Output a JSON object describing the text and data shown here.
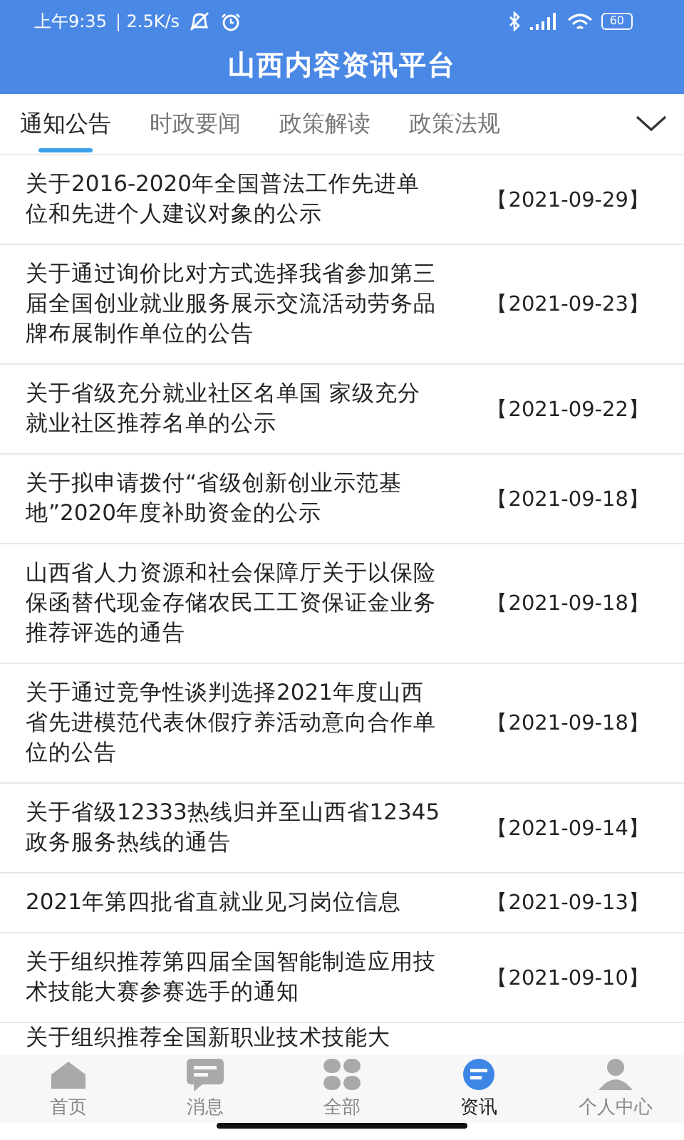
{
  "status_bar": {
    "time": "上午9:35",
    "speed": "| 2.5K/s",
    "battery": "60"
  },
  "header": {
    "title": "山西内容资讯平台"
  },
  "tabs": [
    {
      "label": "通知公告",
      "selected": true
    },
    {
      "label": "时政要闻",
      "selected": false
    },
    {
      "label": "政策解读",
      "selected": false
    },
    {
      "label": "政策法规",
      "selected": false
    }
  ],
  "articles": [
    {
      "title": "关于2016-2020年全国普法工作先进单位和先进个人建议对象的公示",
      "date": "【2021-09-29】"
    },
    {
      "title": "关于通过询价比对方式选择我省参加第三届全国创业就业服务展示交流活动劳务品牌布展制作单位的公告",
      "date": "【2021-09-23】"
    },
    {
      "title": "关于省级充分就业社区名单国 家级充分就业社区推荐名单的公示",
      "date": "【2021-09-22】"
    },
    {
      "title": "关于拟申请拨付“省级创新创业示范基地”2020年度补助资金的公示",
      "date": "【2021-09-18】"
    },
    {
      "title": "山西省人力资源和社会保障厅关于以保险保函替代现金存储农民工工资保证金业务推荐评选的通告",
      "date": "【2021-09-18】"
    },
    {
      "title": "关于通过竞争性谈判选择2021年度山西省先进模范代表休假疗养活动意向合作单位的公告",
      "date": "【2021-09-18】"
    },
    {
      "title": "关于省级12333热线归并至山西省12345政务服务热线的通告",
      "date": "【2021-09-14】"
    },
    {
      "title": "2021年第四批省直就业见习岗位信息",
      "date": "【2021-09-13】"
    },
    {
      "title": "关于组织推荐第四届全国智能制造应用技术技能大赛参赛选手的通知",
      "date": "【2021-09-10】"
    },
    {
      "title": "关于组织推荐全国新职业技术技能大"
    }
  ],
  "bottom_nav": [
    {
      "label": "首页",
      "kind": "home",
      "selected": false
    },
    {
      "label": "消息",
      "kind": "message",
      "selected": false
    },
    {
      "label": "全部",
      "kind": "grid",
      "selected": false
    },
    {
      "label": "资讯",
      "kind": "news",
      "selected": true
    },
    {
      "label": "个人中心",
      "kind": "person",
      "selected": false
    }
  ]
}
